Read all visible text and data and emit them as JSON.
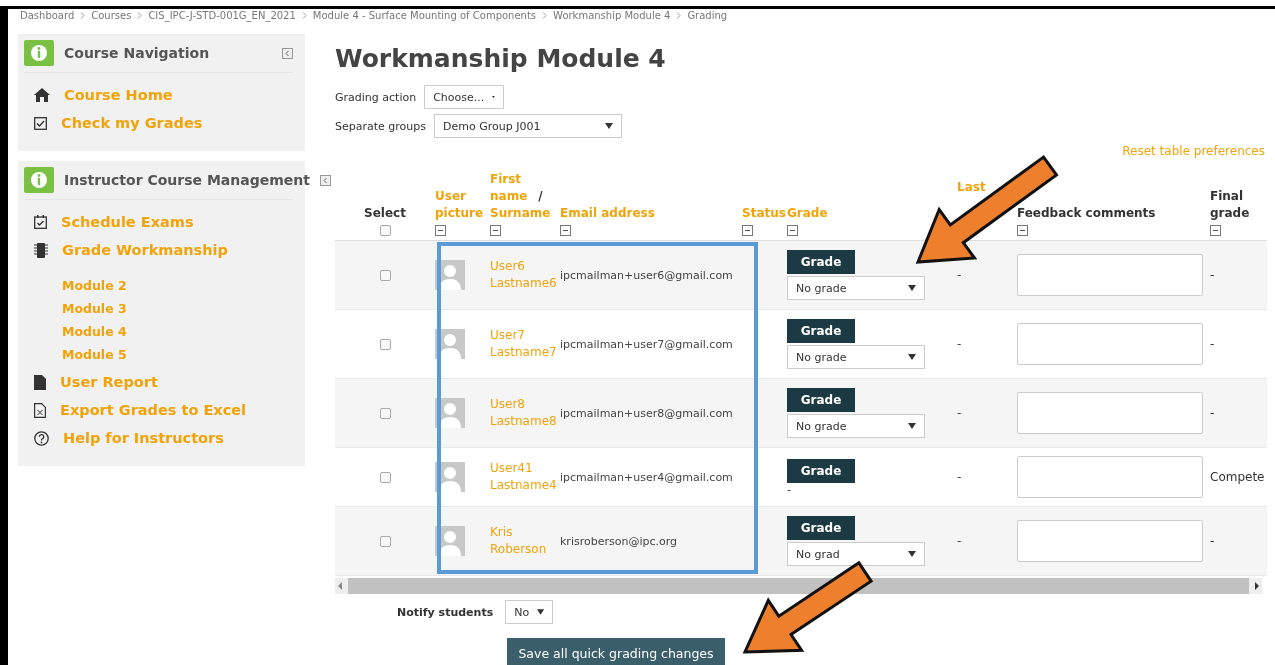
{
  "breadcrumb": [
    "Dashboard",
    "Courses",
    "CIS_IPC-J-STD-001G_EN_2021",
    "Module 4 - Surface Mounting of Components",
    "Workmanship Module 4",
    "Grading"
  ],
  "sidebar": [
    {
      "title": "Course Navigation",
      "items": [
        {
          "label": "Course Home"
        },
        {
          "label": "Check my Grades"
        }
      ]
    },
    {
      "title": "Instructor Course Management",
      "items": [
        {
          "label": "Schedule Exams"
        },
        {
          "label": "Grade Workmanship",
          "children": [
            {
              "label": "Module 2"
            },
            {
              "label": "Module 3"
            },
            {
              "label": "Module 4"
            },
            {
              "label": "Module 5"
            }
          ]
        },
        {
          "label": "User Report"
        },
        {
          "label": "Export Grades to Excel"
        },
        {
          "label": "Help for Instructors"
        }
      ]
    }
  ],
  "page_title": "Workmanship Module 4",
  "grading_action": {
    "label": "Grading action",
    "value": "Choose..."
  },
  "separate_groups": {
    "label": "Separate groups",
    "value": "Demo Group J001"
  },
  "reset_link": "Reset table preferences",
  "table": {
    "columns": [
      {
        "kind": "select",
        "label": "Select",
        "checked": false
      },
      {
        "kind": "link",
        "label": "User picture"
      },
      {
        "kind": "name",
        "first": "First name",
        "separator": "/",
        "second": "Surname"
      },
      {
        "kind": "link",
        "label": "Email address"
      },
      {
        "kind": "link",
        "label": "Status"
      },
      {
        "kind": "link",
        "label": "Grade"
      },
      {
        "kind": "link",
        "label": "Last"
      },
      {
        "kind": "plain",
        "label": "Feedback comments"
      },
      {
        "kind": "plain",
        "label": "Final grade"
      }
    ],
    "rows": [
      {
        "checked": false,
        "first_name": "User6",
        "surname": "Lastname6",
        "email": "ipcmailman+user6@gmail.com",
        "grade_button": "Grade",
        "kind": "select",
        "grade": "No grade",
        "last_modified": "-",
        "final_grade": "-"
      },
      {
        "checked": false,
        "first_name": "User7",
        "surname": "Lastname7",
        "email": "ipcmailman+user7@gmail.com",
        "grade_button": "Grade",
        "kind": "select",
        "grade": "No grade",
        "last_modified": "-",
        "final_grade": "-"
      },
      {
        "checked": false,
        "first_name": "User8",
        "surname": "Lastname8",
        "email": "ipcmailman+user8@gmail.com",
        "grade_button": "Grade",
        "kind": "select",
        "grade": "No grade",
        "last_modified": "-",
        "final_grade": "-"
      },
      {
        "checked": false,
        "first_name": "User41",
        "surname": "Lastname4",
        "email": "ipcmailman+user4@gmail.com",
        "grade_button": "Grade",
        "kind": "text",
        "grade": "-",
        "last_modified": "-",
        "final_grade": "Compete"
      },
      {
        "checked": false,
        "first_name": "Kris",
        "surname": "Roberson",
        "email": "krisroberson@ipc.org",
        "grade_button": "Grade",
        "kind": "select",
        "grade": "No grad",
        "last_modified": "-",
        "final_grade": "-"
      }
    ]
  },
  "notify": {
    "label": "Notify students",
    "value": "No"
  },
  "save_button": "Save all quick grading changes"
}
